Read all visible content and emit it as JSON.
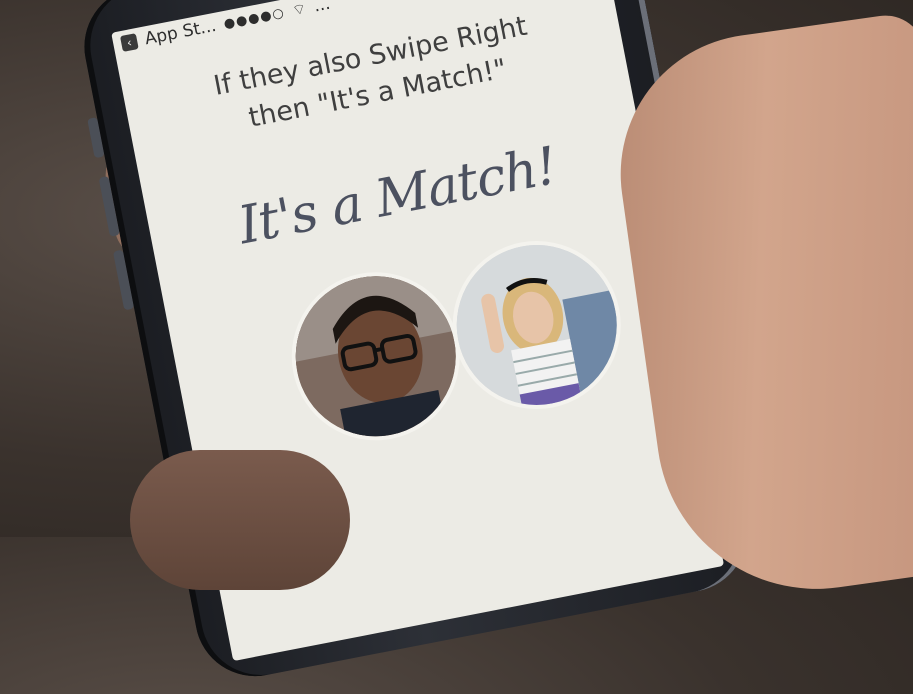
{
  "statusbar": {
    "back_label": "App St...",
    "signal": "●●●●○",
    "carrier": "..."
  },
  "screen": {
    "instructions_line1": "If they also Swipe Right",
    "instructions_line2": "then \"It's a Match!\"",
    "match_title": "It's a Match!"
  },
  "colors": {
    "screen_bg": "#ecebe5",
    "title_color": "#4c5160",
    "text_color": "#3f3f3f"
  },
  "icons": {
    "back": "chevron-left-icon",
    "wifi": "wifi-icon"
  }
}
